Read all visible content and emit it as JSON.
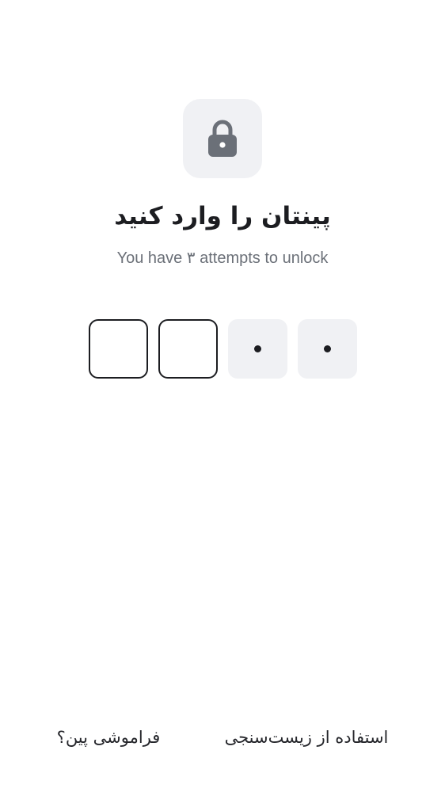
{
  "header": {
    "lock_icon": "lock-icon",
    "title": "پینتان را وارد کنید",
    "subtitle": "You have ۳ attempts to unlock"
  },
  "pin": {
    "length": 4,
    "slots": [
      {
        "state": "empty"
      },
      {
        "state": "empty"
      },
      {
        "state": "filled"
      },
      {
        "state": "filled"
      }
    ]
  },
  "footer": {
    "forgot_pin": "فراموشی پین؟",
    "use_biometric": "استفاده از زیست‌سنجی"
  },
  "colors": {
    "background": "#ffffff",
    "tile": "#f0f1f4",
    "icon": "#6b7078",
    "text": "#1c1d21",
    "muted": "#6b7078"
  }
}
